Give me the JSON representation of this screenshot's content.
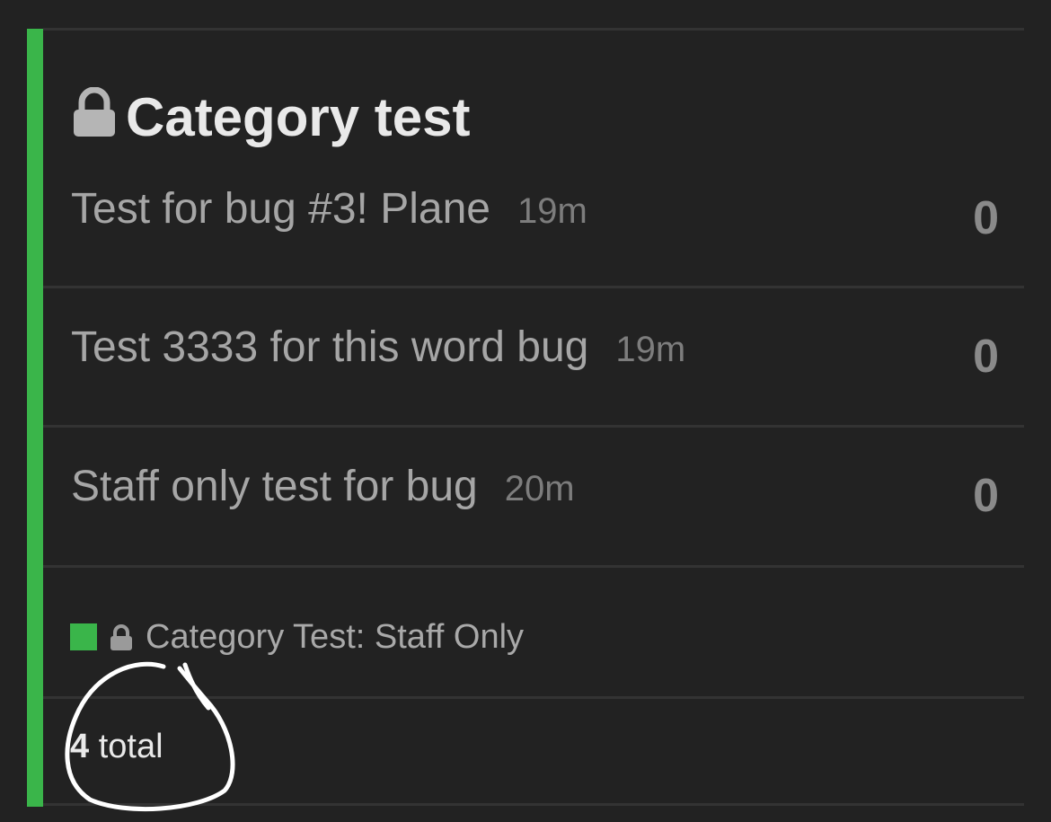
{
  "category": {
    "title": "Category test",
    "lock_icon": "lock-icon",
    "accent_color": "#3ab54a"
  },
  "topics": [
    {
      "title": "Test for bug #3! Plane",
      "age": "19m",
      "count": "0"
    },
    {
      "title": "Test 3333 for this word bug",
      "age": "19m",
      "count": "0"
    },
    {
      "title": "Staff only test for bug",
      "age": "20m",
      "count": "0"
    }
  ],
  "subcategory": {
    "name": "Category Test: Staff Only",
    "color": "#3ab54a",
    "lock_icon": "lock-icon"
  },
  "footer": {
    "total_count": "4",
    "total_label": "total"
  },
  "annotation": {
    "kind": "hand-drawn circle",
    "color": "#ffffff"
  }
}
